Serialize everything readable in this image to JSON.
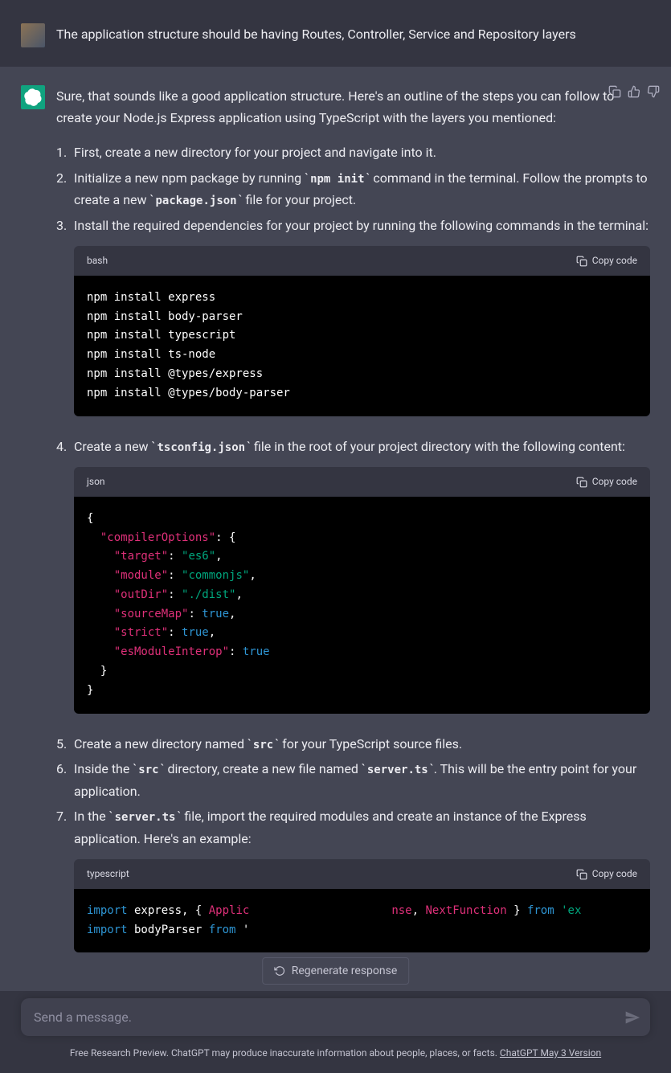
{
  "user_message": "The application structure should be having Routes, Controller, Service and Repository layers",
  "assistant_intro": "Sure, that sounds like a good application structure. Here's an outline of the steps you can follow to create your Node.js Express application using TypeScript with the layers you mentioned:",
  "steps": {
    "s1": "First, create a new directory for your project and navigate into it.",
    "s2_a": "Initialize a new npm package by running ",
    "s2_code1": "npm init",
    "s2_b": " command in the terminal. Follow the prompts to create a new ",
    "s2_code2": "package.json",
    "s2_c": " file for your project.",
    "s3": "Install the required dependencies for your project by running the following commands in the terminal:",
    "s4_a": "Create a new ",
    "s4_code1": "tsconfig.json",
    "s4_b": " file in the root of your project directory with the following content:",
    "s5_a": "Create a new directory named ",
    "s5_code1": "src",
    "s5_b": " for your TypeScript source files.",
    "s6_a": "Inside the ",
    "s6_code1": "src",
    "s6_b": " directory, create a new file named ",
    "s6_code2": "server.ts",
    "s6_c": ". This will be the entry point for your application.",
    "s7_a": "In the ",
    "s7_code1": "server.ts",
    "s7_b": " file, import the required modules and create an instance of the Express application. Here's an example:"
  },
  "code_blocks": {
    "bash": {
      "lang": "bash",
      "content": "npm install express\nnpm install body-parser\nnpm install typescript\nnpm install ts-node\nnpm install @types/express\nnpm install @types/body-parser"
    },
    "json": {
      "lang": "json",
      "tokens": {
        "compilerOptions": "\"compilerOptions\"",
        "target": "\"target\"",
        "target_v": "\"es6\"",
        "module": "\"module\"",
        "module_v": "\"commonjs\"",
        "outDir": "\"outDir\"",
        "outDir_v": "\"./dist\"",
        "sourceMap": "\"sourceMap\"",
        "strict": "\"strict\"",
        "esModuleInterop": "\"esModuleInterop\"",
        "true": "true"
      }
    },
    "typescript": {
      "lang": "typescript",
      "tokens": {
        "import": "import",
        "from": "from",
        "express_var": " express",
        "bodyParser_var": " bodyParser ",
        "Applic": "Applic",
        "nse": "nse",
        "NextFunction": "NextFunction",
        "ex_str": "'ex",
        "from_sp": " from "
      }
    }
  },
  "copy_label": "Copy code",
  "regenerate_label": "Regenerate response",
  "input_placeholder": "Send a message.",
  "footer": {
    "text": "Free Research Preview. ChatGPT may produce inaccurate information about people, places, or facts. ",
    "link": "ChatGPT May 3 Version"
  }
}
